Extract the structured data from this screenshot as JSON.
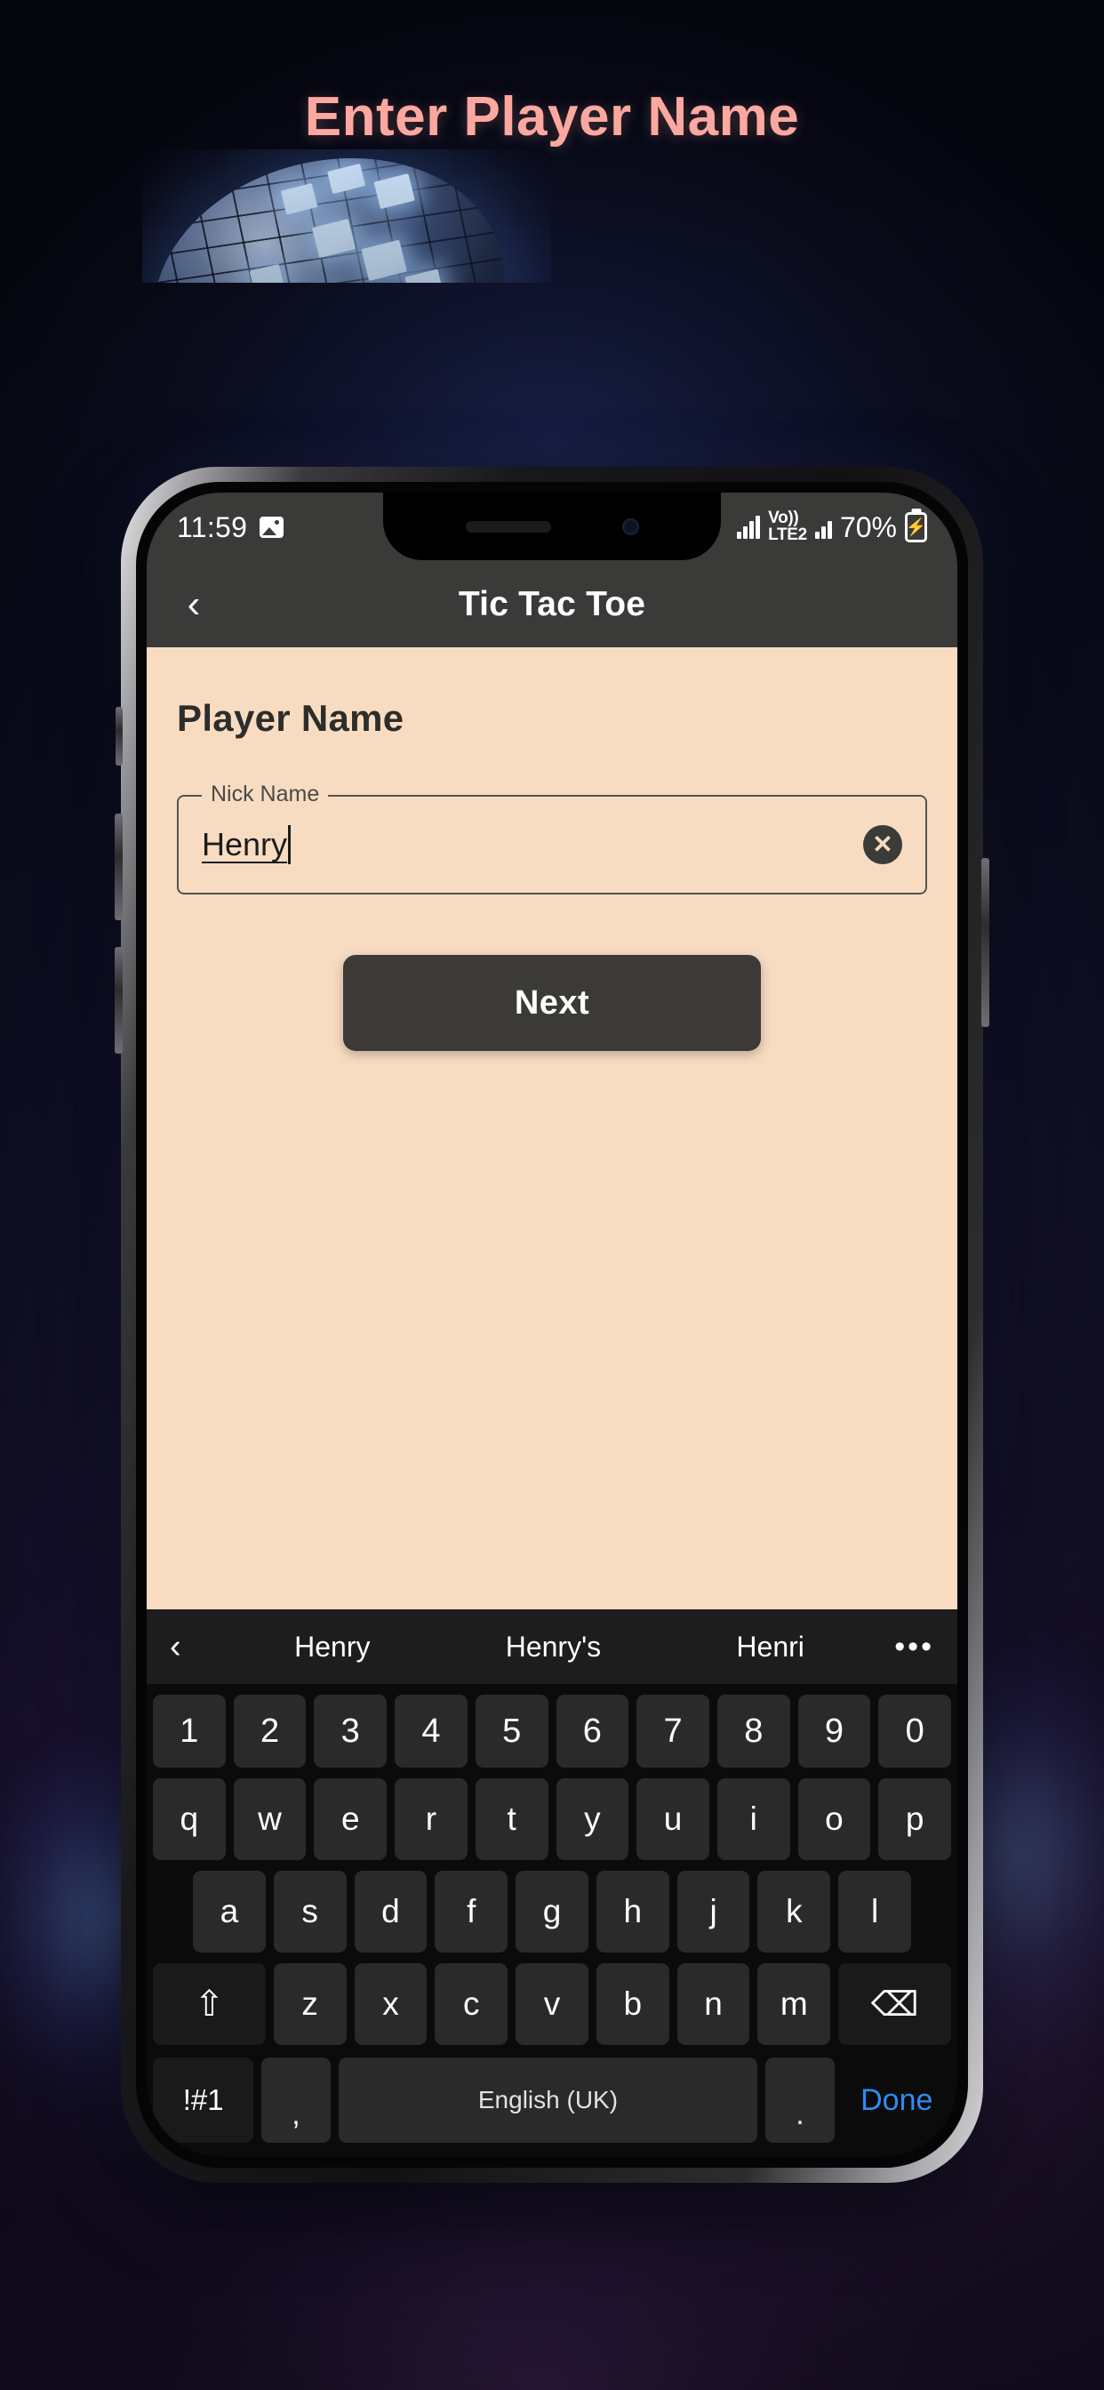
{
  "page": {
    "title": "Enter Player Name",
    "title_color": "#FCA8A0",
    "background_colors": [
      "#0a0c1c",
      "#1c1334",
      "#4a2a63"
    ]
  },
  "status_bar": {
    "time": "11:59",
    "photo_icon": "image-icon",
    "network_label_top": "Vo))",
    "network_label_bottom": "LTE2",
    "battery_percent": "70%",
    "battery_icon": "battery-charging-icon"
  },
  "app_bar": {
    "back_icon": "chevron-left-icon",
    "title": "Tic Tac Toe",
    "background": "#3a3a38"
  },
  "content": {
    "background": "#F8DCC2",
    "heading": "Player Name",
    "field": {
      "label": "Nick Name",
      "value": "Henry",
      "clear_icon": "close-circle-icon"
    },
    "next_label": "Next"
  },
  "keyboard": {
    "suggestion_back_icon": "chevron-left-icon",
    "suggestions": [
      "Henry",
      "Henry's",
      "Henri"
    ],
    "more_icon": "•••",
    "rows": {
      "numbers": [
        "1",
        "2",
        "3",
        "4",
        "5",
        "6",
        "7",
        "8",
        "9",
        "0"
      ],
      "top": [
        "q",
        "w",
        "e",
        "r",
        "t",
        "y",
        "u",
        "i",
        "o",
        "p"
      ],
      "home": [
        "a",
        "s",
        "d",
        "f",
        "g",
        "h",
        "j",
        "k",
        "l"
      ],
      "bottom": [
        "z",
        "x",
        "c",
        "v",
        "b",
        "n",
        "m"
      ]
    },
    "shift_icon": "⇧",
    "backspace_icon": "⌫",
    "symbols_label": "!#1",
    "comma_label": ",",
    "space_label": "English (UK)",
    "period_label": ".",
    "done_label": "Done",
    "done_color": "#2f8bf5"
  }
}
